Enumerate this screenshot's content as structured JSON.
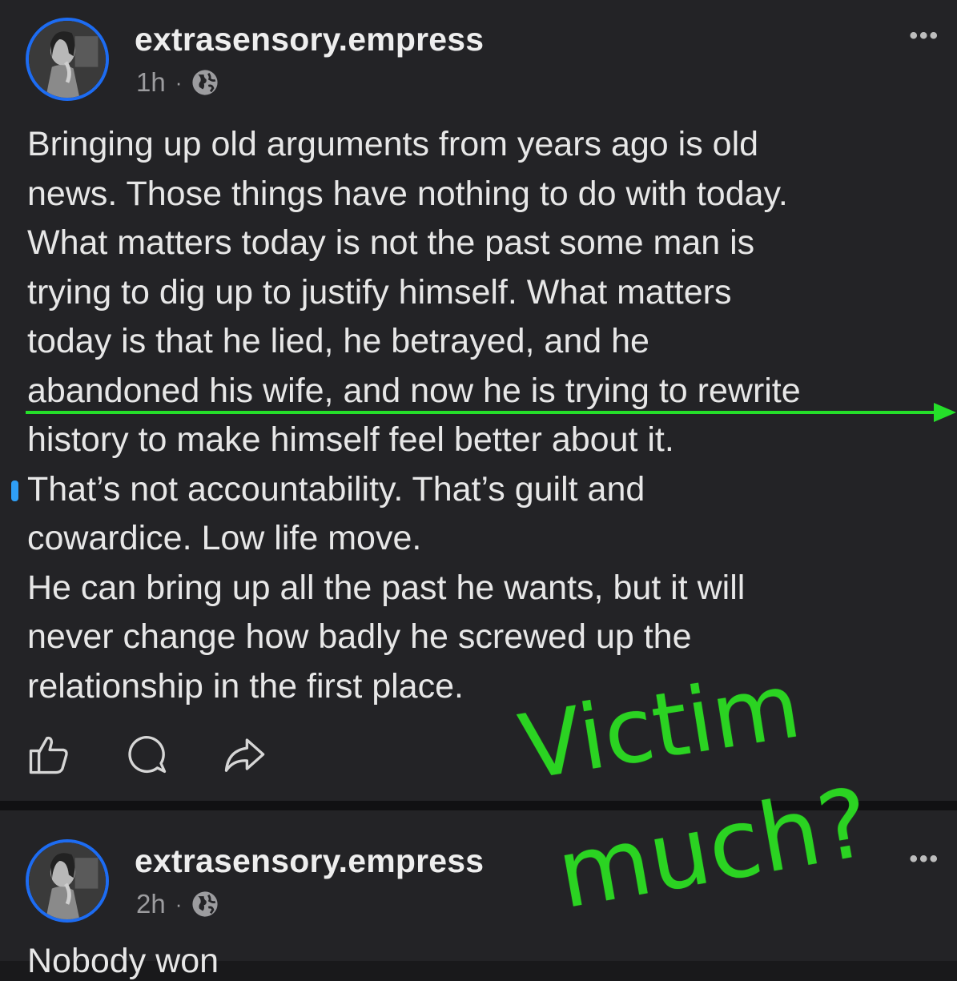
{
  "posts": [
    {
      "username": "extrasensory.empress",
      "time": "1h",
      "separator": "·",
      "visibility_icon": "globe-icon",
      "more_icon": "•••",
      "body_lines": [
        "Bringing up old arguments from years ago is old",
        "news. Those things have nothing to do with today.",
        "What matters today is not the past some man is",
        "trying to dig up to justify himself. What matters",
        "today is that he lied, he betrayed, and he",
        "abandoned his wife, and now he is trying to rewrite",
        "history to make himself feel better about it.",
        "That’s not accountability. That’s guilt and",
        "cowardice. Low life move.",
        "He can bring up all the past he wants, but it will",
        "never change how badly he screwed up the",
        "relationship in the first place."
      ],
      "actions": [
        "like-icon",
        "comment-icon",
        "share-icon"
      ]
    },
    {
      "username": "extrasensory.empress",
      "time": "2h",
      "separator": "·",
      "visibility_icon": "globe-icon",
      "more_icon": "•••",
      "body_start": "Nobody won"
    }
  ],
  "annotation": {
    "line1": "Victim",
    "line2": "much?",
    "color": "#2bd322"
  },
  "colors": {
    "background": "#232326",
    "avatar_ring": "#1d6cf2",
    "underline": "#25df2a",
    "meta_text": "#9c9c9f"
  }
}
